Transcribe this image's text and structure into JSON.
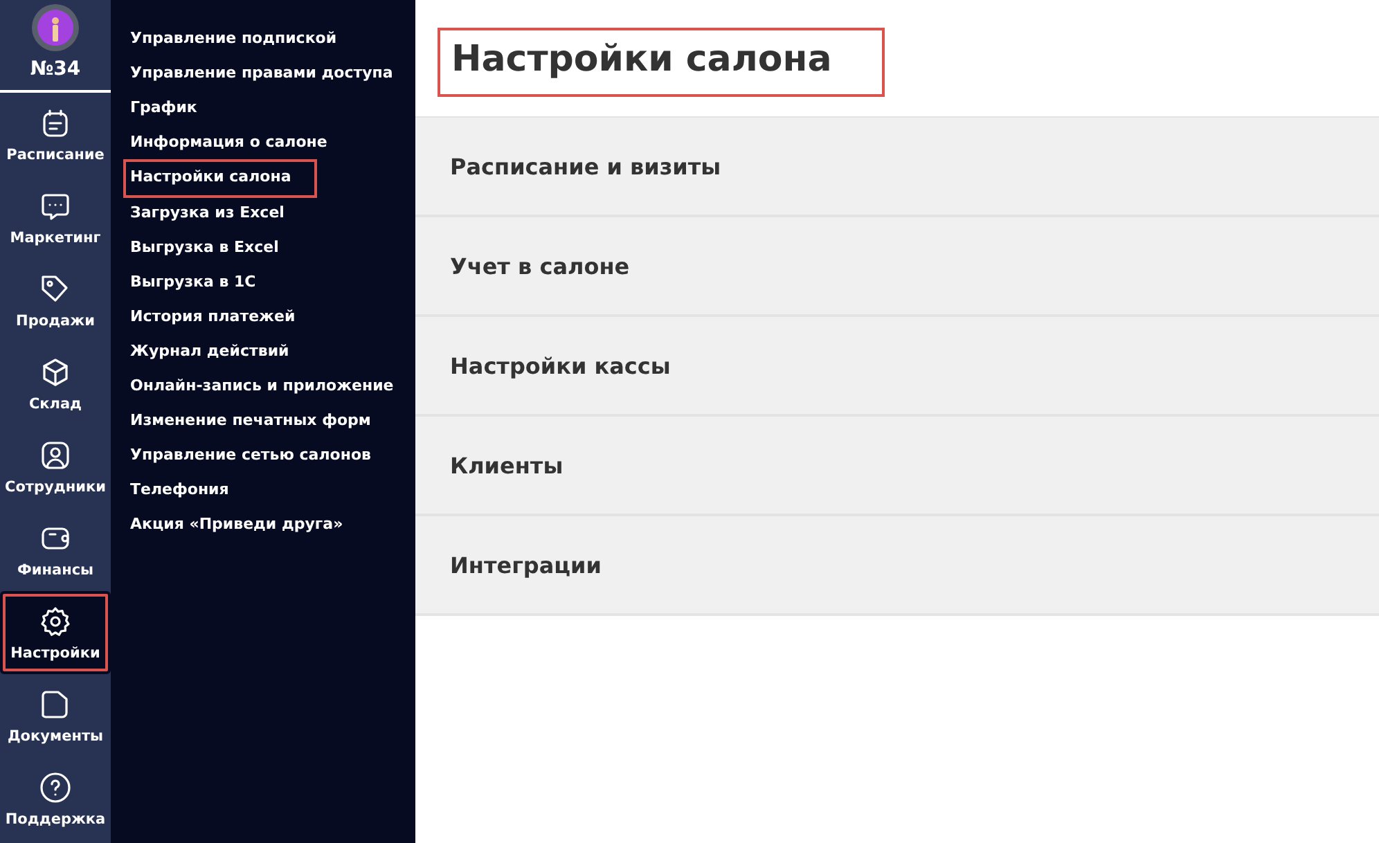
{
  "account": {
    "number": "№34"
  },
  "nav": [
    {
      "label": "Расписание",
      "kind": "calendar",
      "selected": false,
      "highlighted": false
    },
    {
      "label": "Маркетинг",
      "kind": "chat",
      "selected": false,
      "highlighted": false
    },
    {
      "label": "Продажи",
      "kind": "tag",
      "selected": false,
      "highlighted": false
    },
    {
      "label": "Склад",
      "kind": "box",
      "selected": false,
      "highlighted": false
    },
    {
      "label": "Сотрудники",
      "kind": "person",
      "selected": false,
      "highlighted": false
    },
    {
      "label": "Финансы",
      "kind": "wallet",
      "selected": false,
      "highlighted": false
    },
    {
      "label": "Настройки",
      "kind": "gear",
      "selected": true,
      "highlighted": true
    },
    {
      "label": "Документы",
      "kind": "folder",
      "selected": false,
      "highlighted": false
    },
    {
      "label": "Поддержка",
      "kind": "help",
      "selected": false,
      "highlighted": false
    }
  ],
  "submenu": [
    {
      "label": "Управление подпиской",
      "highlighted": false
    },
    {
      "label": "Управление правами доступа",
      "highlighted": false
    },
    {
      "label": "График",
      "highlighted": false
    },
    {
      "label": "Информация о салоне",
      "highlighted": false
    },
    {
      "label": "Настройки салона",
      "highlighted": true
    },
    {
      "label": "Загрузка из Excel",
      "highlighted": false
    },
    {
      "label": "Выгрузка в Excel",
      "highlighted": false
    },
    {
      "label": "Выгрузка в 1С",
      "highlighted": false
    },
    {
      "label": "История платежей",
      "highlighted": false
    },
    {
      "label": "Журнал действий",
      "highlighted": false
    },
    {
      "label": "Онлайн-запись и приложение",
      "highlighted": false
    },
    {
      "label": "Изменение печатных форм",
      "highlighted": false
    },
    {
      "label": "Управление сетью салонов",
      "highlighted": false
    },
    {
      "label": "Телефония",
      "highlighted": false
    },
    {
      "label": "Акция «Приведи друга»",
      "highlighted": false
    }
  ],
  "page": {
    "title": "Настройки салона",
    "title_highlighted": true
  },
  "sections": [
    "Расписание и визиты",
    "Учет в салоне",
    "Настройки кассы",
    "Клиенты",
    "Интеграции"
  ]
}
